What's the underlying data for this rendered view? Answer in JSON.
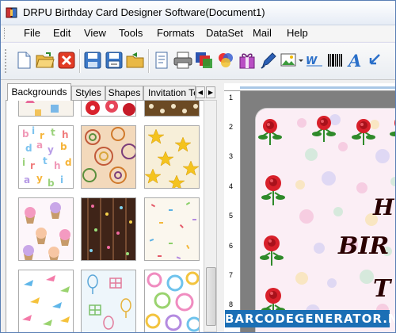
{
  "window": {
    "title": "DRPU Birthday Card Designer Software(Document1)"
  },
  "menu": {
    "items": [
      "File",
      "Edit",
      "View",
      "Tools",
      "Formats",
      "DataSet",
      "Mail",
      "Help"
    ]
  },
  "toolbar": {
    "buttons": [
      {
        "icon": "new-document-icon"
      },
      {
        "icon": "open-folder-icon"
      },
      {
        "icon": "close-icon"
      },
      {
        "icon": "save-icon"
      },
      {
        "icon": "save-as-icon"
      },
      {
        "icon": "export-folder-icon"
      },
      {
        "icon": "document-properties-icon"
      },
      {
        "icon": "print-icon"
      },
      {
        "icon": "layers-icon"
      },
      {
        "icon": "color-palette-icon"
      },
      {
        "icon": "gift-icon"
      },
      {
        "icon": "pen-icon"
      },
      {
        "icon": "picture-icon"
      },
      {
        "icon": "wordart-icon"
      },
      {
        "icon": "barcode-icon"
      },
      {
        "icon": "text-icon"
      },
      {
        "icon": "arrow-icon"
      }
    ]
  },
  "left_panel": {
    "tabs": [
      "Backgrounds",
      "Styles",
      "Shapes",
      "Invitation Te"
    ],
    "active_tab": "Backgrounds",
    "thumbnails": [
      {
        "name": "background-thumb-1",
        "pattern": "clothes"
      },
      {
        "name": "background-thumb-2",
        "pattern": "flowers"
      },
      {
        "name": "background-thumb-3",
        "pattern": "brown-dots"
      },
      {
        "name": "background-thumb-4",
        "pattern": "birthday-letters"
      },
      {
        "name": "background-thumb-5",
        "pattern": "paisley"
      },
      {
        "name": "background-thumb-6",
        "pattern": "yellow-stars"
      },
      {
        "name": "background-thumb-7",
        "pattern": "cupcakes"
      },
      {
        "name": "background-thumb-8",
        "pattern": "dark-confetti"
      },
      {
        "name": "background-thumb-9",
        "pattern": "sprinkles"
      },
      {
        "name": "background-thumb-10",
        "pattern": "party-horns"
      },
      {
        "name": "background-thumb-11",
        "pattern": "gifts-balloons"
      },
      {
        "name": "background-thumb-12",
        "pattern": "circles"
      }
    ]
  },
  "ruler": {
    "numbers": [
      "1",
      "2",
      "3",
      "4",
      "5",
      "6",
      "7",
      "8"
    ]
  },
  "card": {
    "line1": "H",
    "line2": "BIR",
    "line3": "T"
  },
  "watermark": {
    "text": "BARCODEGENERATOR.NET"
  },
  "colors": {
    "window_border": "#5a7fb5",
    "canvas_bg": "#7f7f7f",
    "watermark_bg": "#1b6fb5",
    "rose_red": "#d8202a",
    "leaf_green": "#2f8a2a"
  }
}
